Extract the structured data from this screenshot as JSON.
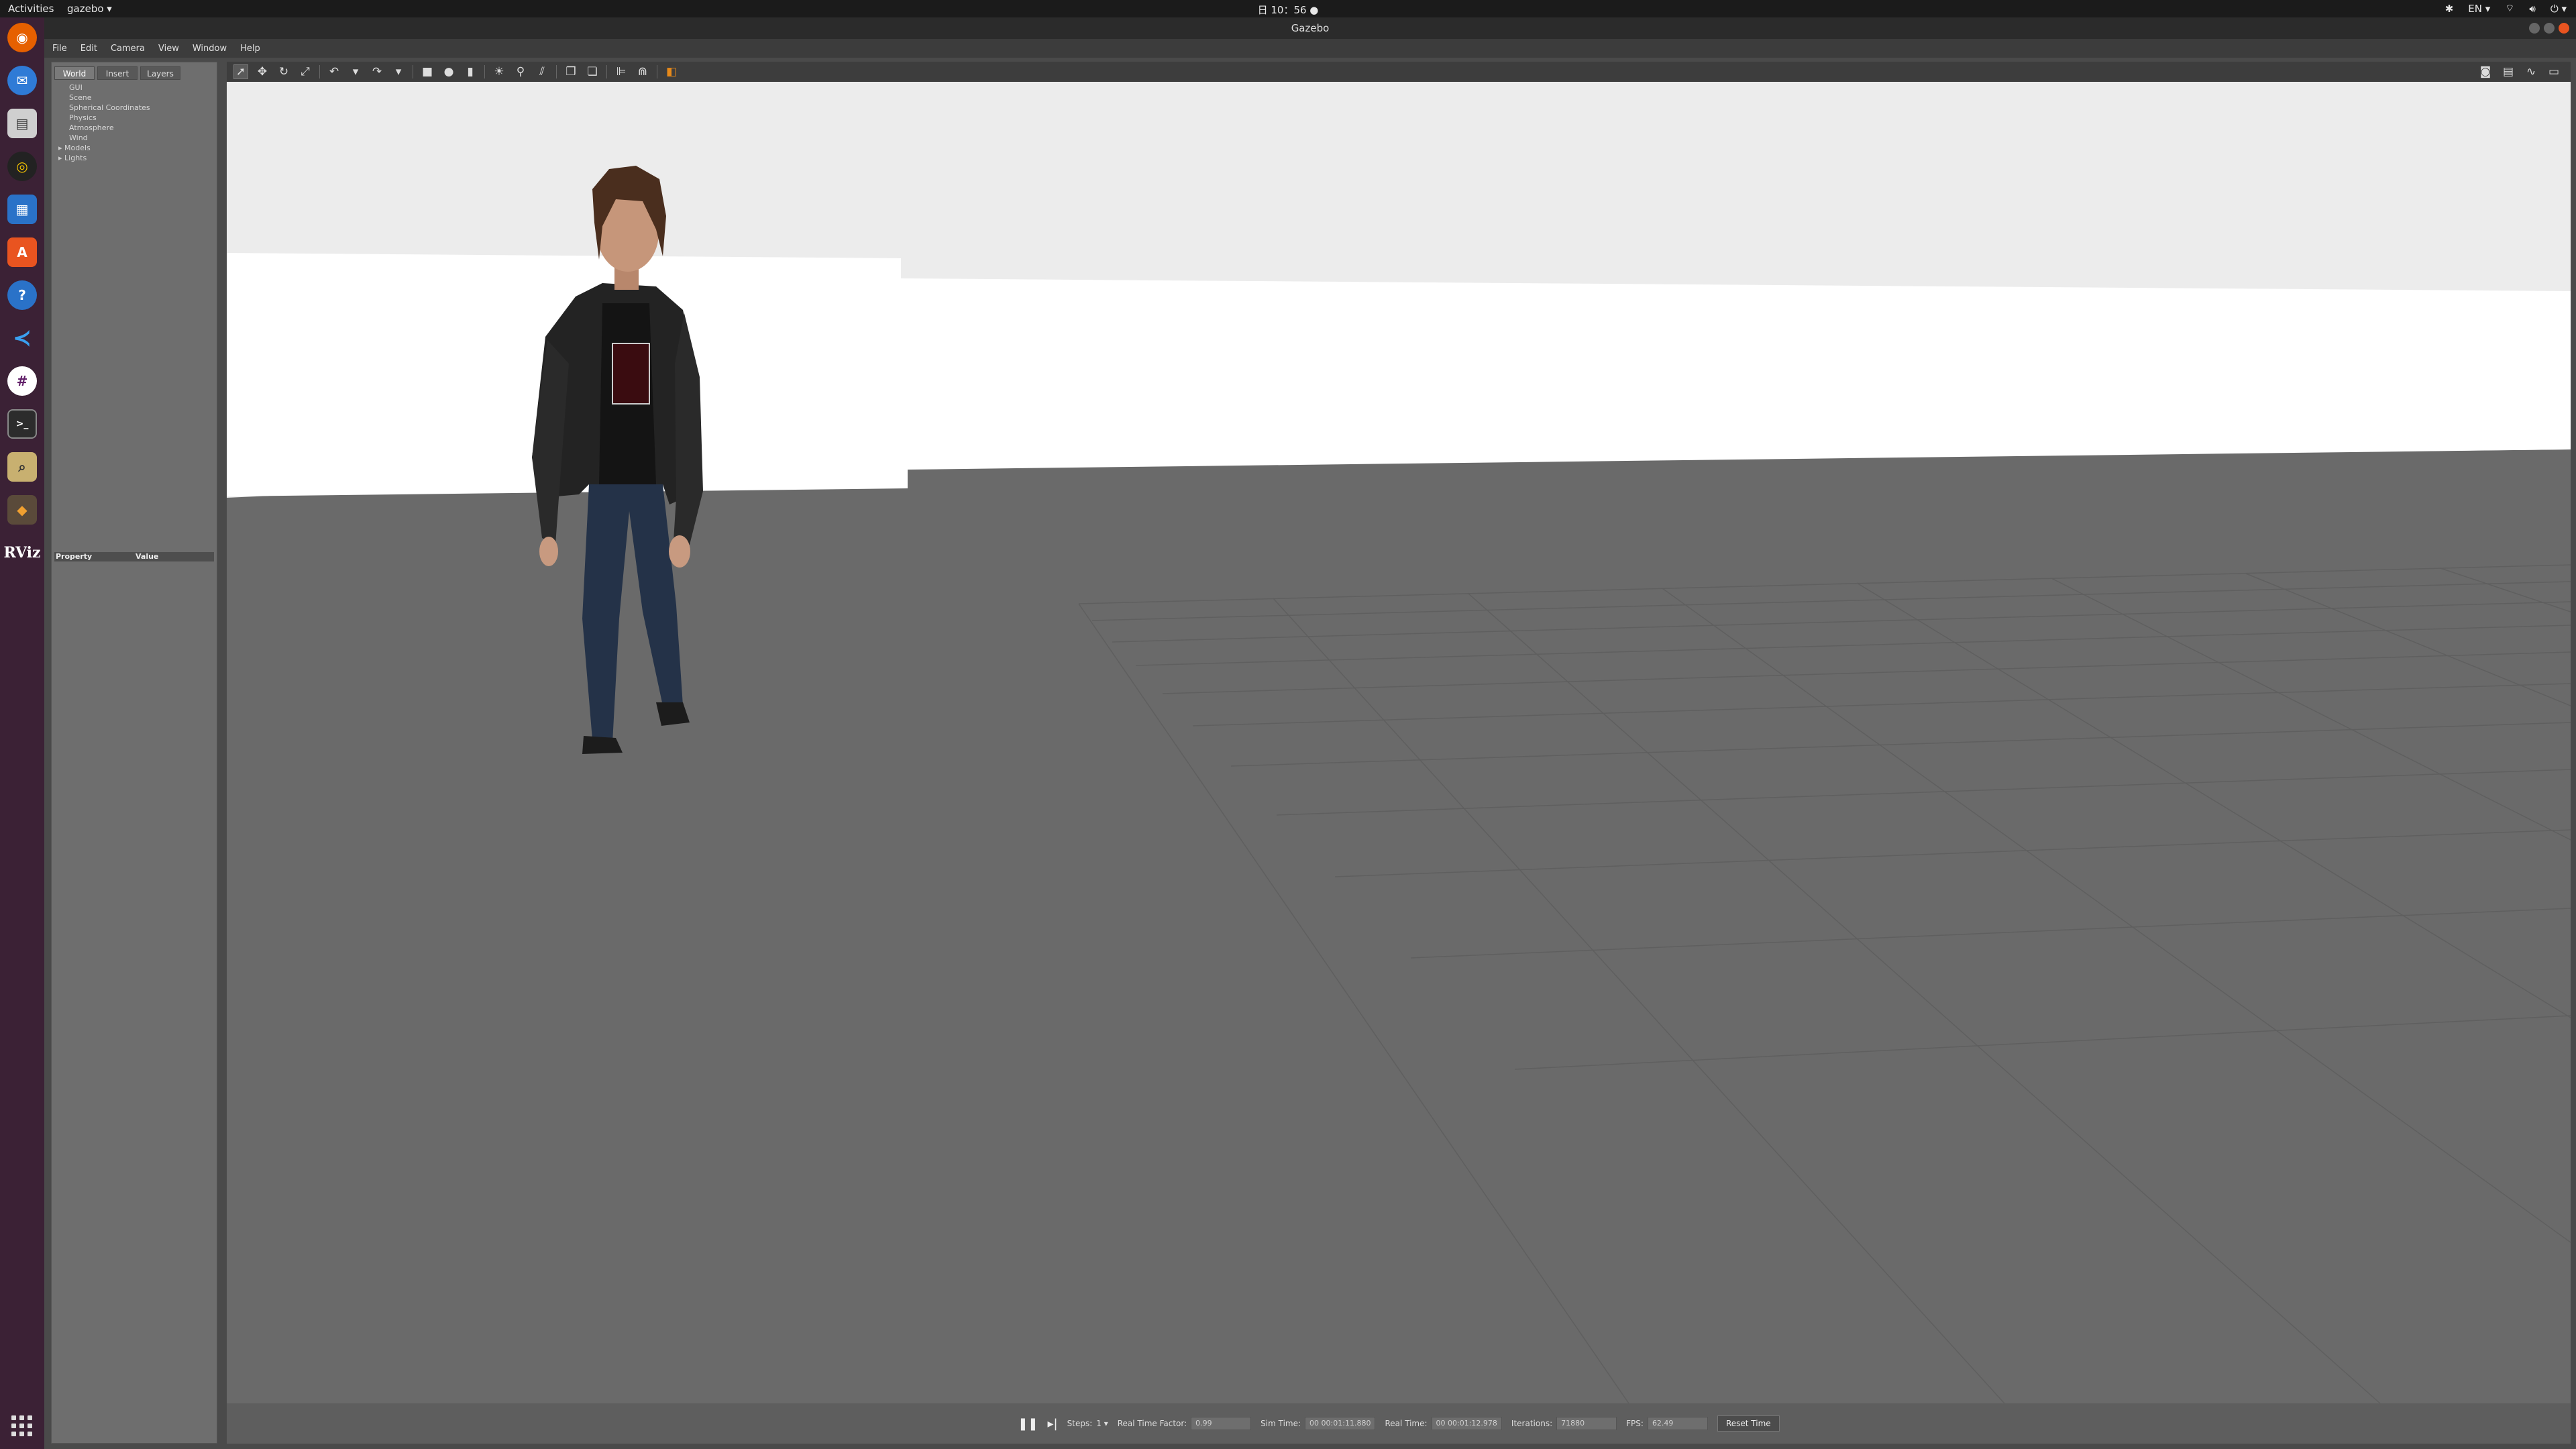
{
  "topbar": {
    "activities": "Activities",
    "app_menu": "gazebo ▾",
    "clock": "日 10：56 ●",
    "lang": "EN ▾"
  },
  "window": {
    "title": "Gazebo"
  },
  "menu": [
    "File",
    "Edit",
    "Camera",
    "View",
    "Window",
    "Help"
  ],
  "left_panel": {
    "tabs": [
      "World",
      "Insert",
      "Layers"
    ],
    "tree": [
      {
        "label": "GUI",
        "expandable": false
      },
      {
        "label": "Scene",
        "expandable": false
      },
      {
        "label": "Spherical Coordinates",
        "expandable": false
      },
      {
        "label": "Physics",
        "expandable": false
      },
      {
        "label": "Atmosphere",
        "expandable": false
      },
      {
        "label": "Wind",
        "expandable": false
      },
      {
        "label": "Models",
        "expandable": true
      },
      {
        "label": "Lights",
        "expandable": true
      }
    ],
    "property_header": "Property",
    "value_header": "Value"
  },
  "statusbar": {
    "steps_label": "Steps:",
    "steps_value": "1 ▾",
    "rtf_label": "Real Time Factor:",
    "rtf_value": "0.99",
    "simtime_label": "Sim Time:",
    "simtime_value": "00 00:01:11.880",
    "realtime_label": "Real Time:",
    "realtime_value": "00 00:01:12.978",
    "iterations_label": "Iterations:",
    "iterations_value": "71880",
    "fps_label": "FPS:",
    "fps_value": "62.49",
    "reset_button": "Reset Time"
  },
  "colors": {
    "dock": "#3b2135",
    "ground": "#6a6a6a",
    "sky": "#ececec",
    "accent": "#e95420"
  }
}
